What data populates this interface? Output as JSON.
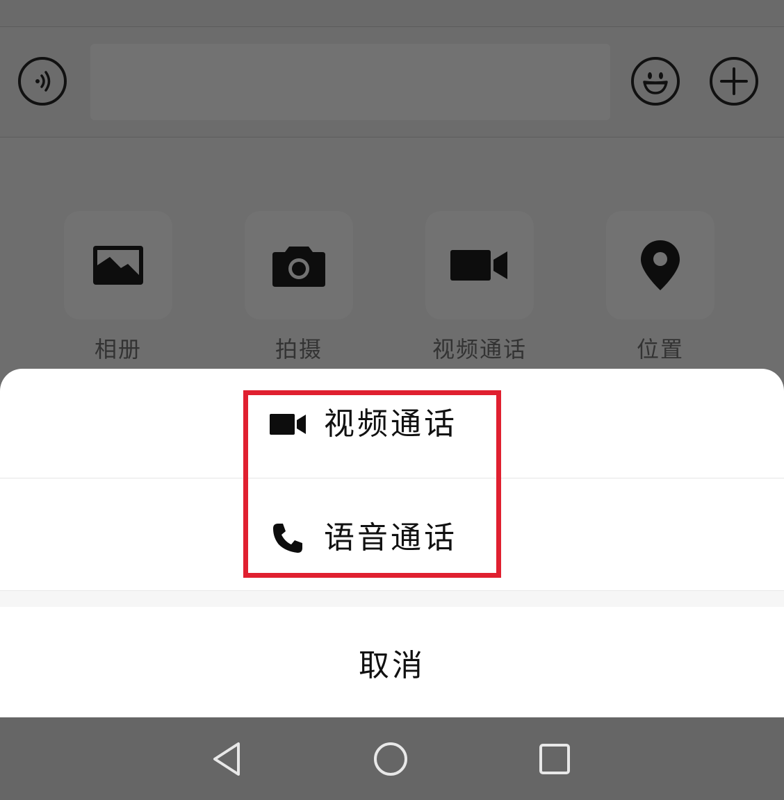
{
  "input_bar": {
    "voice_icon": "voice-wave-icon",
    "emoji_icon": "smile-icon",
    "plus_icon": "plus-icon",
    "input_placeholder": ""
  },
  "tools": [
    {
      "label": "相册",
      "icon": "image-icon"
    },
    {
      "label": "拍摄",
      "icon": "camera-icon"
    },
    {
      "label": "视频通话",
      "icon": "video-camera-icon"
    },
    {
      "label": "位置",
      "icon": "location-pin-icon"
    }
  ],
  "sheet": {
    "options": [
      {
        "label": "视频通话",
        "icon": "video-camera-icon"
      },
      {
        "label": "语音通话",
        "icon": "phone-icon"
      }
    ],
    "cancel_label": "取消"
  },
  "colors": {
    "highlight": "#e02030",
    "overlay": "#6e6e6e",
    "sheet": "#ffffff"
  },
  "nav": {
    "back_icon": "back-triangle-icon",
    "home_icon": "home-circle-icon",
    "recent_icon": "recent-square-icon"
  }
}
